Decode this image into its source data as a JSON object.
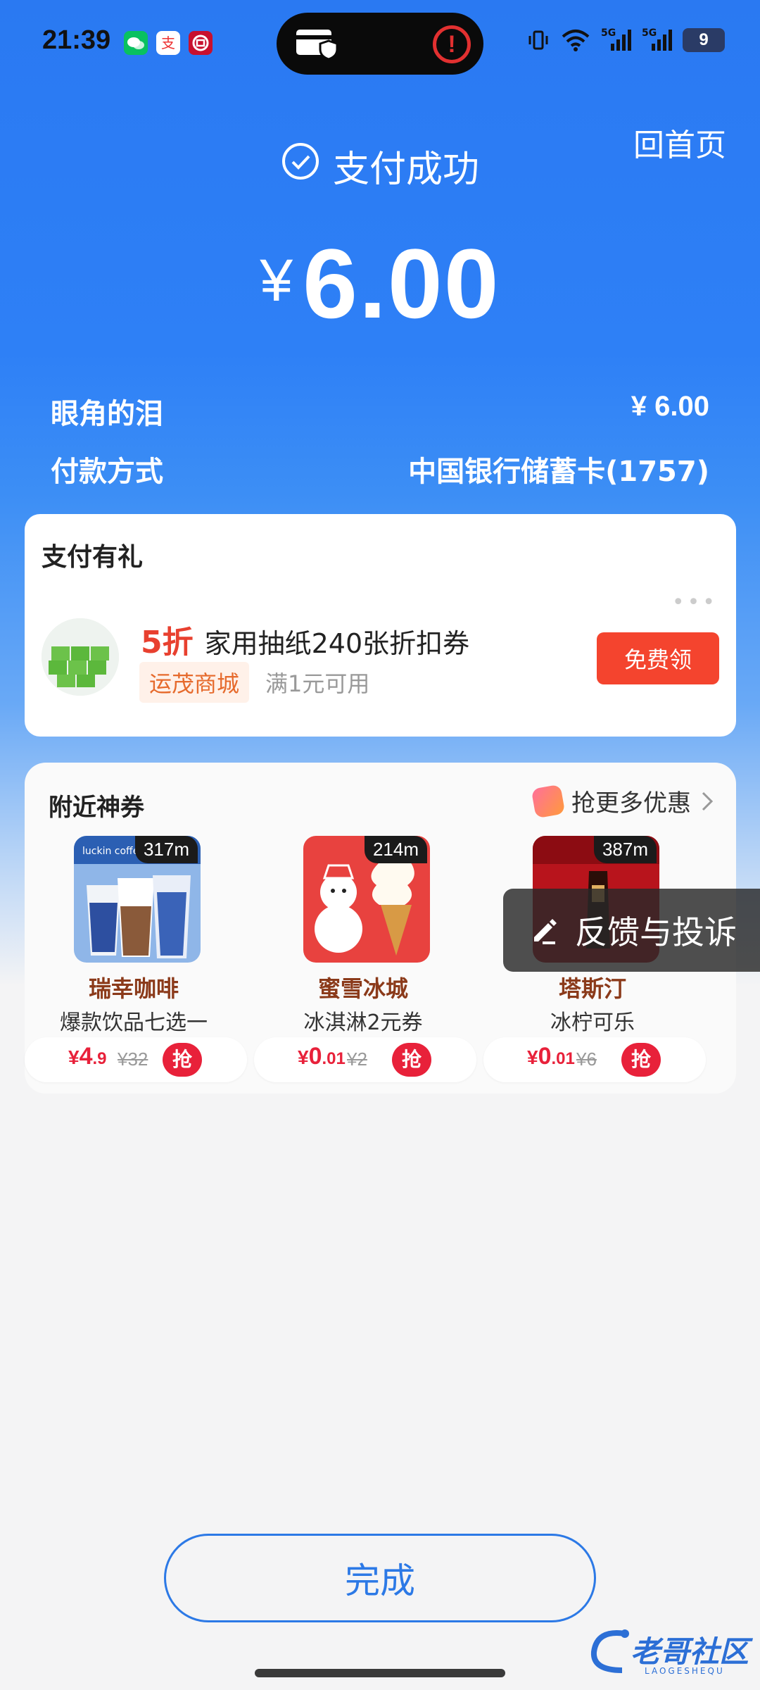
{
  "status_bar": {
    "time": "21:39",
    "battery": "9",
    "signal_1": "5G",
    "signal_2": "5G",
    "icons": [
      "wechat-icon",
      "alipay-icon",
      "boc-icon",
      "card-shield-icon",
      "alert-icon",
      "vibrate-icon",
      "wifi-icon"
    ]
  },
  "header": {
    "home_link": "回首页",
    "status_text": "支付成功",
    "currency": "¥",
    "amount": "6.00"
  },
  "details": {
    "payee_label": "眼角的泪",
    "payee_amount": "¥ 6.00",
    "method_label": "付款方式",
    "method_value": "中国银行储蓄卡(1757)"
  },
  "gift": {
    "title": "支付有礼",
    "discount": "5折",
    "desc": "家用抽纸240张折扣券",
    "shop_tag": "运茂商城",
    "condition": "满1元可用",
    "button": "免费领"
  },
  "nearby": {
    "title": "附近神券",
    "more": "抢更多优惠",
    "items": [
      {
        "distance": "317m",
        "name": "瑞幸咖啡",
        "desc": "爆款饮品七选一",
        "price_yen": "¥",
        "price_main": "4",
        "price_small": ".9",
        "orig": "¥32",
        "grab": "抢"
      },
      {
        "distance": "214m",
        "name": "蜜雪冰城",
        "desc": "冰淇淋2元券",
        "price_yen": "¥",
        "price_main": "0",
        "price_small": ".01",
        "orig": "¥2",
        "grab": "抢"
      },
      {
        "distance": "387m",
        "name": "塔斯汀",
        "desc": "冰柠可乐",
        "price_yen": "¥",
        "price_main": "0",
        "price_small": ".01",
        "orig": "¥6",
        "grab": "抢"
      }
    ]
  },
  "feedback": {
    "label": "反馈与投诉"
  },
  "done_button": "完成",
  "watermark": {
    "text": "老哥社区",
    "sub": "LAOGESHEQU"
  },
  "colors": {
    "primary_blue": "#2e80f6",
    "red": "#f4442e",
    "price_red": "#e8213a",
    "brown": "#8b3a1a"
  }
}
